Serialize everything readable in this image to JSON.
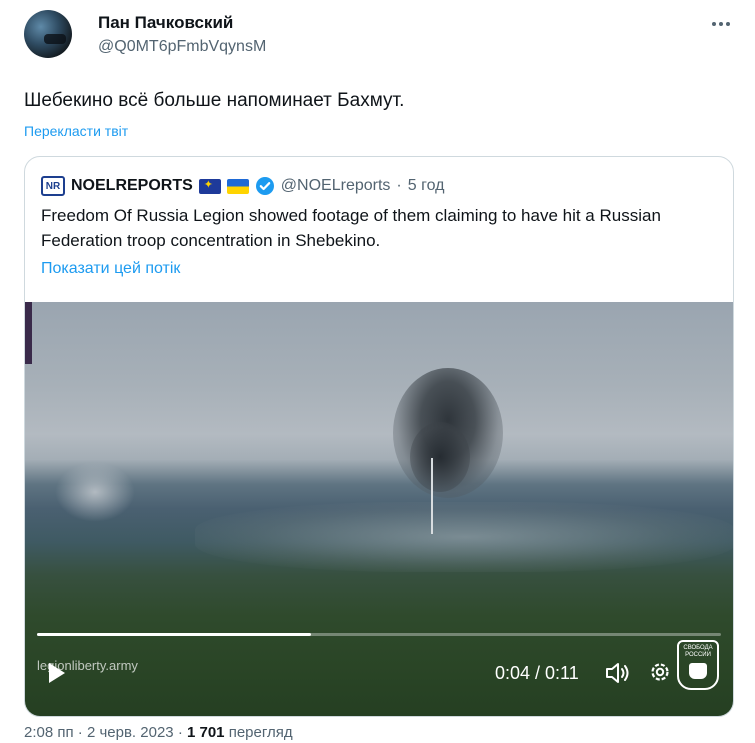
{
  "author": {
    "name": "Пан Пачковский",
    "handle": "@Q0MT6pFmbVqynsM"
  },
  "tweet": {
    "text": "Шебекино всё больше напоминает Бахмут.",
    "translate_label": "Перекласти твіт"
  },
  "quoted": {
    "logo_text": "NR",
    "name": "NOELREPORTS",
    "handle": "@NOELreports",
    "separator": "·",
    "time_ago": "5 год",
    "text": "Freedom Of Russia Legion showed footage of them claiming to have hit a Russian Federation troop concentration in Shebekino.",
    "show_thread_label": "Показати цей потік",
    "video": {
      "watermark": "legionliberty.army",
      "time_display": "0:04 / 0:11",
      "progress": 0.4,
      "logo_text_1": "СВОБОДА",
      "logo_text_2": "РОССИИ"
    }
  },
  "meta": {
    "time": "2:08 пп",
    "date": "2 черв. 2023",
    "separator": "·",
    "views_count": "1 701",
    "views_label": "перегляд"
  },
  "colors": {
    "accent": "#1d9bf0",
    "secondary_text": "#536471"
  }
}
